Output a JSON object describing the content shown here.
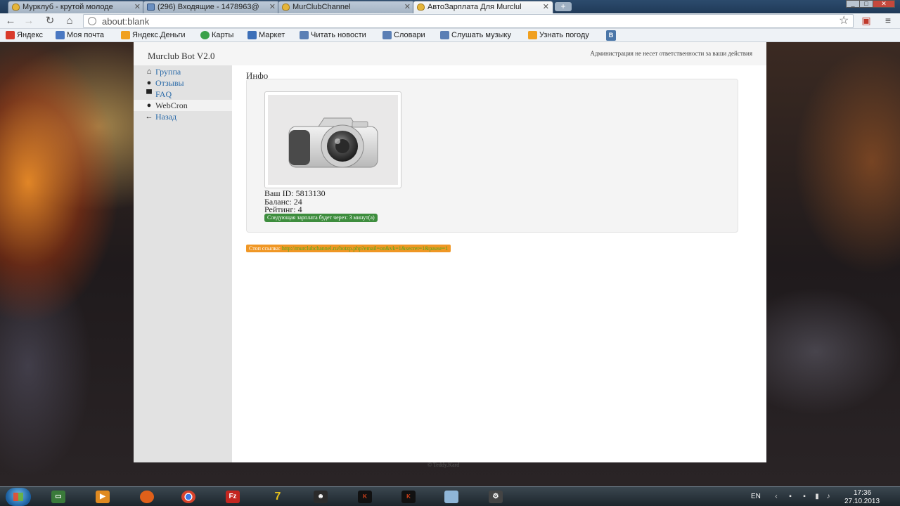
{
  "browser": {
    "tabs": [
      {
        "title": "Мурклуб - крутой молоде",
        "icon": "chat-bubble-icon",
        "active": false
      },
      {
        "title": "(296) Входящие - 1478963@",
        "icon": "mail-icon",
        "active": false
      },
      {
        "title": "MurClubChannel",
        "icon": "chat-bubble-icon",
        "active": false
      },
      {
        "title": "АвтоЗарплата Для Murclul",
        "icon": "chat-bubble-icon",
        "active": true
      }
    ],
    "new_tab_label": "+",
    "url": "about:blank",
    "bookmarks": [
      {
        "label": "Яндекс",
        "icon": "yandex-icon",
        "color": "#d93a2b"
      },
      {
        "label": "Моя почта",
        "icon": "mail-icon",
        "color": "#4a78c2"
      },
      {
        "label": "Яндекс.Деньги",
        "icon": "money-icon",
        "color": "#f0a020"
      },
      {
        "label": "Карты",
        "icon": "map-icon",
        "color": "#3aa14a"
      },
      {
        "label": "Маркет",
        "icon": "market-icon",
        "color": "#3c6fb8"
      },
      {
        "label": "Читать новости",
        "icon": "news-icon",
        "color": "#5a7fb5"
      },
      {
        "label": "Словари",
        "icon": "dictionary-icon",
        "color": "#5a7fb5"
      },
      {
        "label": "Слушать музыку",
        "icon": "music-icon",
        "color": "#5a7fb5"
      },
      {
        "label": "Узнать погоду",
        "icon": "weather-icon",
        "color": "#f0a020"
      },
      {
        "label": "В",
        "icon": "vk-icon",
        "color": "#4a76a8"
      }
    ]
  },
  "page": {
    "brand": "Murclub Bot V2.0",
    "disclaimer": "Администрация не несет ответственности за ваши действия",
    "sidebar": [
      {
        "label": "Группа",
        "icon": "home-icon",
        "glyph": "⌂",
        "active": false
      },
      {
        "label": "Отзывы",
        "icon": "info-icon",
        "glyph": "●",
        "active": false
      },
      {
        "label": "FAQ",
        "icon": "comment-icon",
        "glyph": "▀",
        "active": false
      },
      {
        "label": "WebCron",
        "icon": "check-circle-icon",
        "glyph": "●",
        "active": true
      },
      {
        "label": "Назад",
        "icon": "arrow-left-icon",
        "glyph": "←",
        "active": false
      }
    ],
    "content_title": "Инфо",
    "user": {
      "id_line": "Ваш ID: 5813130",
      "balance_line": "Баланс: 24",
      "rating_line": "Рейтинг: 4"
    },
    "next_salary_badge": "Следующая зарплата будет через: 3 минут(а)",
    "stop_link_label": "Стоп ссылка:",
    "stop_link_url": "http://murclubchannel.ru/botzp.php?email=on&vk=1&secret=1&pause=1",
    "footer": "© Teddy.Kard",
    "accent_colors": {
      "green_badge": "#3d8d3d",
      "orange_badge": "#f09725",
      "link": "#2a6aa8"
    }
  },
  "taskbar": {
    "apps": [
      {
        "name": "start-button",
        "icon": "windows-flag-icon"
      },
      {
        "name": "terminal",
        "icon": "terminal-icon",
        "color": "#3a7a3a"
      },
      {
        "name": "media-player",
        "icon": "play-icon",
        "color": "#e08a20"
      },
      {
        "name": "firefox",
        "icon": "firefox-icon",
        "color": "#e0601a"
      },
      {
        "name": "chrome",
        "icon": "chrome-icon",
        "color": "#d8432c"
      },
      {
        "name": "filezilla",
        "icon": "filezilla-icon",
        "color": "#c42620"
      },
      {
        "name": "7zip",
        "icon": "7zip-icon",
        "color": "#2a2a2a"
      },
      {
        "name": "app-face",
        "icon": "face-icon",
        "color": "#2b2b2b"
      },
      {
        "name": "kard-1",
        "icon": "kard-icon",
        "color": "#111111"
      },
      {
        "name": "kard-2",
        "icon": "kard-icon",
        "color": "#111111"
      },
      {
        "name": "notepad",
        "icon": "notepad-icon",
        "color": "#8fb6d8"
      },
      {
        "name": "app-tools",
        "icon": "tools-icon",
        "color": "#444444"
      }
    ],
    "language": "EN",
    "time": "17:36",
    "date": "27.10.2013"
  }
}
